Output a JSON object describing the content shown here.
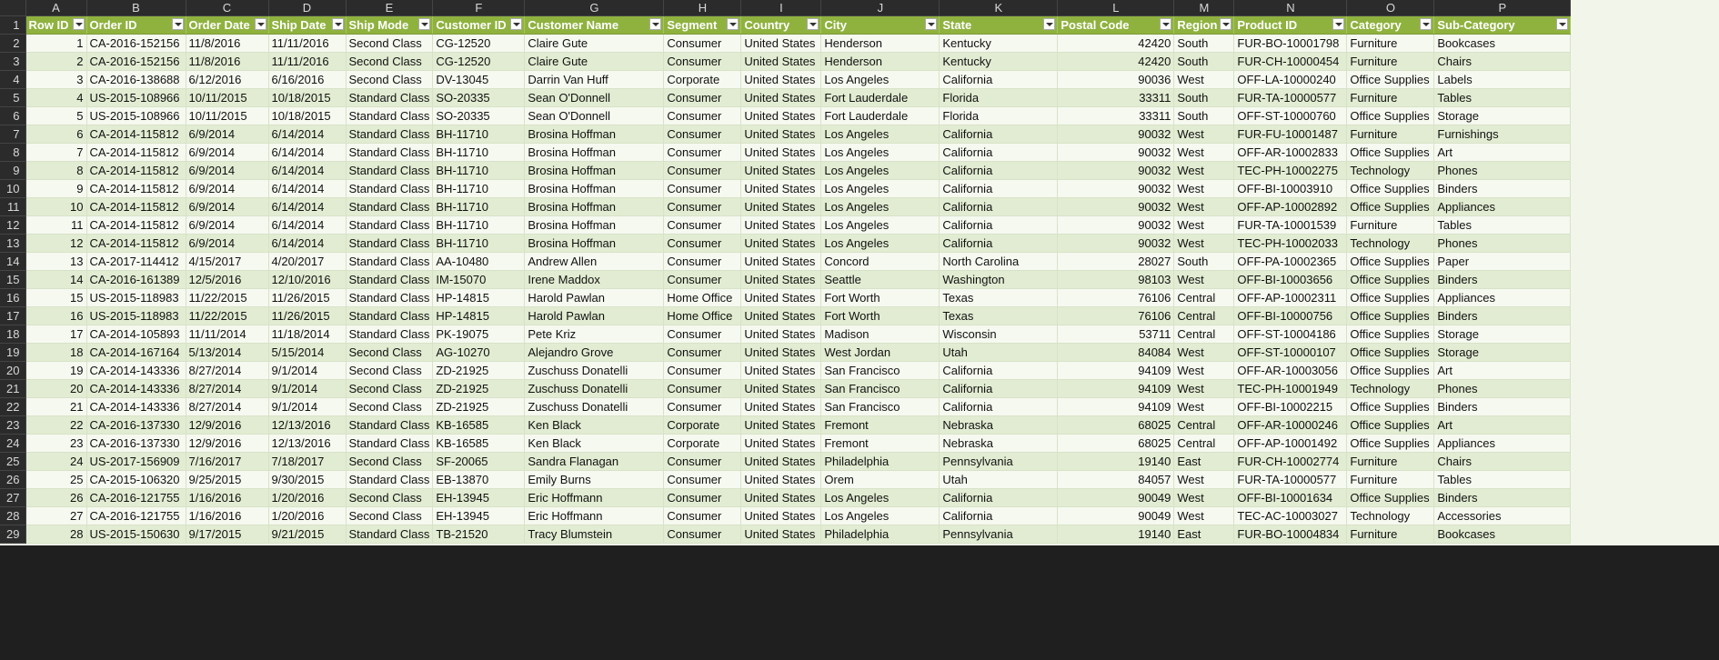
{
  "columns": [
    "A",
    "B",
    "C",
    "D",
    "E",
    "F",
    "G",
    "H",
    "I",
    "J",
    "K",
    "L",
    "M",
    "N",
    "O",
    "P"
  ],
  "headers": [
    "Row ID",
    "Order ID",
    "Order Date",
    "Ship Date",
    "Ship Mode",
    "Customer ID",
    "Customer Name",
    "Segment",
    "Country",
    "City",
    "State",
    "Postal Code",
    "Region",
    "Product ID",
    "Category",
    "Sub-Category"
  ],
  "rows": [
    [
      "1",
      "CA-2016-152156",
      "11/8/2016",
      "11/11/2016",
      "Second Class",
      "CG-12520",
      "Claire Gute",
      "Consumer",
      "United States",
      "Henderson",
      "Kentucky",
      "42420",
      "South",
      "FUR-BO-10001798",
      "Furniture",
      "Bookcases"
    ],
    [
      "2",
      "CA-2016-152156",
      "11/8/2016",
      "11/11/2016",
      "Second Class",
      "CG-12520",
      "Claire Gute",
      "Consumer",
      "United States",
      "Henderson",
      "Kentucky",
      "42420",
      "South",
      "FUR-CH-10000454",
      "Furniture",
      "Chairs"
    ],
    [
      "3",
      "CA-2016-138688",
      "6/12/2016",
      "6/16/2016",
      "Second Class",
      "DV-13045",
      "Darrin Van Huff",
      "Corporate",
      "United States",
      "Los Angeles",
      "California",
      "90036",
      "West",
      "OFF-LA-10000240",
      "Office Supplies",
      "Labels"
    ],
    [
      "4",
      "US-2015-108966",
      "10/11/2015",
      "10/18/2015",
      "Standard Class",
      "SO-20335",
      "Sean O'Donnell",
      "Consumer",
      "United States",
      "Fort Lauderdale",
      "Florida",
      "33311",
      "South",
      "FUR-TA-10000577",
      "Furniture",
      "Tables"
    ],
    [
      "5",
      "US-2015-108966",
      "10/11/2015",
      "10/18/2015",
      "Standard Class",
      "SO-20335",
      "Sean O'Donnell",
      "Consumer",
      "United States",
      "Fort Lauderdale",
      "Florida",
      "33311",
      "South",
      "OFF-ST-10000760",
      "Office Supplies",
      "Storage"
    ],
    [
      "6",
      "CA-2014-115812",
      "6/9/2014",
      "6/14/2014",
      "Standard Class",
      "BH-11710",
      "Brosina Hoffman",
      "Consumer",
      "United States",
      "Los Angeles",
      "California",
      "90032",
      "West",
      "FUR-FU-10001487",
      "Furniture",
      "Furnishings"
    ],
    [
      "7",
      "CA-2014-115812",
      "6/9/2014",
      "6/14/2014",
      "Standard Class",
      "BH-11710",
      "Brosina Hoffman",
      "Consumer",
      "United States",
      "Los Angeles",
      "California",
      "90032",
      "West",
      "OFF-AR-10002833",
      "Office Supplies",
      "Art"
    ],
    [
      "8",
      "CA-2014-115812",
      "6/9/2014",
      "6/14/2014",
      "Standard Class",
      "BH-11710",
      "Brosina Hoffman",
      "Consumer",
      "United States",
      "Los Angeles",
      "California",
      "90032",
      "West",
      "TEC-PH-10002275",
      "Technology",
      "Phones"
    ],
    [
      "9",
      "CA-2014-115812",
      "6/9/2014",
      "6/14/2014",
      "Standard Class",
      "BH-11710",
      "Brosina Hoffman",
      "Consumer",
      "United States",
      "Los Angeles",
      "California",
      "90032",
      "West",
      "OFF-BI-10003910",
      "Office Supplies",
      "Binders"
    ],
    [
      "10",
      "CA-2014-115812",
      "6/9/2014",
      "6/14/2014",
      "Standard Class",
      "BH-11710",
      "Brosina Hoffman",
      "Consumer",
      "United States",
      "Los Angeles",
      "California",
      "90032",
      "West",
      "OFF-AP-10002892",
      "Office Supplies",
      "Appliances"
    ],
    [
      "11",
      "CA-2014-115812",
      "6/9/2014",
      "6/14/2014",
      "Standard Class",
      "BH-11710",
      "Brosina Hoffman",
      "Consumer",
      "United States",
      "Los Angeles",
      "California",
      "90032",
      "West",
      "FUR-TA-10001539",
      "Furniture",
      "Tables"
    ],
    [
      "12",
      "CA-2014-115812",
      "6/9/2014",
      "6/14/2014",
      "Standard Class",
      "BH-11710",
      "Brosina Hoffman",
      "Consumer",
      "United States",
      "Los Angeles",
      "California",
      "90032",
      "West",
      "TEC-PH-10002033",
      "Technology",
      "Phones"
    ],
    [
      "13",
      "CA-2017-114412",
      "4/15/2017",
      "4/20/2017",
      "Standard Class",
      "AA-10480",
      "Andrew Allen",
      "Consumer",
      "United States",
      "Concord",
      "North Carolina",
      "28027",
      "South",
      "OFF-PA-10002365",
      "Office Supplies",
      "Paper"
    ],
    [
      "14",
      "CA-2016-161389",
      "12/5/2016",
      "12/10/2016",
      "Standard Class",
      "IM-15070",
      "Irene Maddox",
      "Consumer",
      "United States",
      "Seattle",
      "Washington",
      "98103",
      "West",
      "OFF-BI-10003656",
      "Office Supplies",
      "Binders"
    ],
    [
      "15",
      "US-2015-118983",
      "11/22/2015",
      "11/26/2015",
      "Standard Class",
      "HP-14815",
      "Harold Pawlan",
      "Home Office",
      "United States",
      "Fort Worth",
      "Texas",
      "76106",
      "Central",
      "OFF-AP-10002311",
      "Office Supplies",
      "Appliances"
    ],
    [
      "16",
      "US-2015-118983",
      "11/22/2015",
      "11/26/2015",
      "Standard Class",
      "HP-14815",
      "Harold Pawlan",
      "Home Office",
      "United States",
      "Fort Worth",
      "Texas",
      "76106",
      "Central",
      "OFF-BI-10000756",
      "Office Supplies",
      "Binders"
    ],
    [
      "17",
      "CA-2014-105893",
      "11/11/2014",
      "11/18/2014",
      "Standard Class",
      "PK-19075",
      "Pete Kriz",
      "Consumer",
      "United States",
      "Madison",
      "Wisconsin",
      "53711",
      "Central",
      "OFF-ST-10004186",
      "Office Supplies",
      "Storage"
    ],
    [
      "18",
      "CA-2014-167164",
      "5/13/2014",
      "5/15/2014",
      "Second Class",
      "AG-10270",
      "Alejandro Grove",
      "Consumer",
      "United States",
      "West Jordan",
      "Utah",
      "84084",
      "West",
      "OFF-ST-10000107",
      "Office Supplies",
      "Storage"
    ],
    [
      "19",
      "CA-2014-143336",
      "8/27/2014",
      "9/1/2014",
      "Second Class",
      "ZD-21925",
      "Zuschuss Donatelli",
      "Consumer",
      "United States",
      "San Francisco",
      "California",
      "94109",
      "West",
      "OFF-AR-10003056",
      "Office Supplies",
      "Art"
    ],
    [
      "20",
      "CA-2014-143336",
      "8/27/2014",
      "9/1/2014",
      "Second Class",
      "ZD-21925",
      "Zuschuss Donatelli",
      "Consumer",
      "United States",
      "San Francisco",
      "California",
      "94109",
      "West",
      "TEC-PH-10001949",
      "Technology",
      "Phones"
    ],
    [
      "21",
      "CA-2014-143336",
      "8/27/2014",
      "9/1/2014",
      "Second Class",
      "ZD-21925",
      "Zuschuss Donatelli",
      "Consumer",
      "United States",
      "San Francisco",
      "California",
      "94109",
      "West",
      "OFF-BI-10002215",
      "Office Supplies",
      "Binders"
    ],
    [
      "22",
      "CA-2016-137330",
      "12/9/2016",
      "12/13/2016",
      "Standard Class",
      "KB-16585",
      "Ken Black",
      "Corporate",
      "United States",
      "Fremont",
      "Nebraska",
      "68025",
      "Central",
      "OFF-AR-10000246",
      "Office Supplies",
      "Art"
    ],
    [
      "23",
      "CA-2016-137330",
      "12/9/2016",
      "12/13/2016",
      "Standard Class",
      "KB-16585",
      "Ken Black",
      "Corporate",
      "United States",
      "Fremont",
      "Nebraska",
      "68025",
      "Central",
      "OFF-AP-10001492",
      "Office Supplies",
      "Appliances"
    ],
    [
      "24",
      "US-2017-156909",
      "7/16/2017",
      "7/18/2017",
      "Second Class",
      "SF-20065",
      "Sandra Flanagan",
      "Consumer",
      "United States",
      "Philadelphia",
      "Pennsylvania",
      "19140",
      "East",
      "FUR-CH-10002774",
      "Furniture",
      "Chairs"
    ],
    [
      "25",
      "CA-2015-106320",
      "9/25/2015",
      "9/30/2015",
      "Standard Class",
      "EB-13870",
      "Emily Burns",
      "Consumer",
      "United States",
      "Orem",
      "Utah",
      "84057",
      "West",
      "FUR-TA-10000577",
      "Furniture",
      "Tables"
    ],
    [
      "26",
      "CA-2016-121755",
      "1/16/2016",
      "1/20/2016",
      "Second Class",
      "EH-13945",
      "Eric Hoffmann",
      "Consumer",
      "United States",
      "Los Angeles",
      "California",
      "90049",
      "West",
      "OFF-BI-10001634",
      "Office Supplies",
      "Binders"
    ],
    [
      "27",
      "CA-2016-121755",
      "1/16/2016",
      "1/20/2016",
      "Second Class",
      "EH-13945",
      "Eric Hoffmann",
      "Consumer",
      "United States",
      "Los Angeles",
      "California",
      "90049",
      "West",
      "TEC-AC-10003027",
      "Technology",
      "Accessories"
    ],
    [
      "28",
      "US-2015-150630",
      "9/17/2015",
      "9/21/2015",
      "Standard Class",
      "TB-21520",
      "Tracy Blumstein",
      "Consumer",
      "United States",
      "Philadelphia",
      "Pennsylvania",
      "19140",
      "East",
      "FUR-BO-10004834",
      "Furniture",
      "Bookcases"
    ]
  ],
  "colors": {
    "header_green": "#8fb23f",
    "band_dark": "#e2ecd2",
    "band_light": "#f6f9f0",
    "chrome": "#2b2b2b"
  }
}
